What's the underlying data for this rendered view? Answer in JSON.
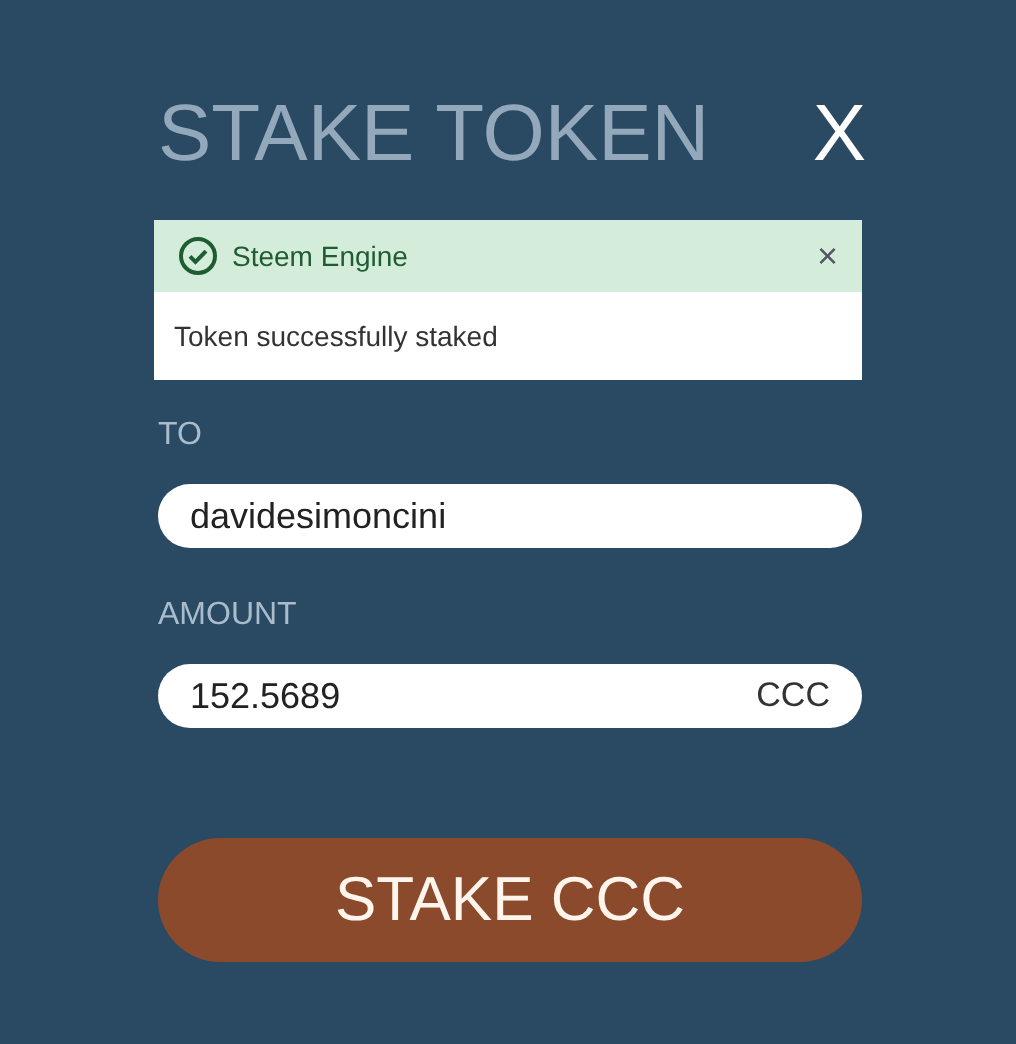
{
  "dialog": {
    "title": "STAKE TOKEN",
    "close": "X"
  },
  "notification": {
    "title": "Steem Engine",
    "close": "×",
    "message": "Token successfully staked"
  },
  "fields": [
    {
      "label": "TO",
      "value": "davidesimoncini"
    },
    {
      "label": "AMOUNT",
      "value": "152.5689",
      "suffix": "CCC"
    }
  ],
  "submit": "STAKE CCC"
}
